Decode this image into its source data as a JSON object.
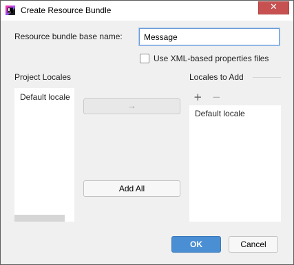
{
  "window": {
    "title": "Create Resource Bundle",
    "close_glyph": "✕"
  },
  "form": {
    "base_name_label": "Resource bundle base name:",
    "base_name_value": "Message",
    "xml_checkbox_label": "Use XML-based properties files",
    "xml_checkbox_checked": false
  },
  "project_locales": {
    "title": "Project Locales",
    "items": [
      "Default locale"
    ]
  },
  "locales_to_add": {
    "title": "Locales to Add",
    "add_glyph": "+",
    "remove_glyph": "−",
    "items": [
      "Default locale"
    ]
  },
  "transfer": {
    "move_glyph": "→",
    "add_all_label": "Add All"
  },
  "footer": {
    "ok_label": "OK",
    "cancel_label": "Cancel"
  },
  "colors": {
    "accent": "#4a8fd4",
    "close": "#c75050"
  }
}
